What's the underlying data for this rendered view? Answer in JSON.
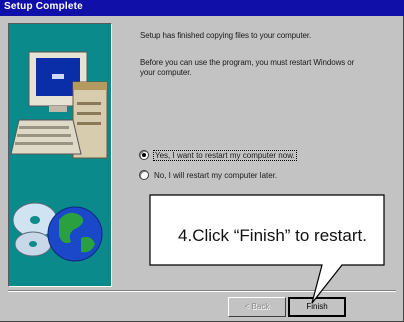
{
  "window": {
    "title": "Setup Complete"
  },
  "message": {
    "line1": "Setup has finished copying files to your computer.",
    "line2a": "Before you can use the program, you must restart Windows or",
    "line2b": "your computer."
  },
  "options": [
    {
      "label": "Yes, I want to restart my computer now.",
      "selected": true
    },
    {
      "label": "No, I will restart my computer later.",
      "selected": false
    }
  ],
  "buttons": {
    "back": "< Back",
    "finish": "Finish"
  },
  "callout": {
    "text": "4.Click “Finish” to restart."
  },
  "colors": {
    "title_bar": "#1010a8",
    "dialog_bg": "#c3c3c3",
    "art_bg": "#0a8a8a"
  }
}
